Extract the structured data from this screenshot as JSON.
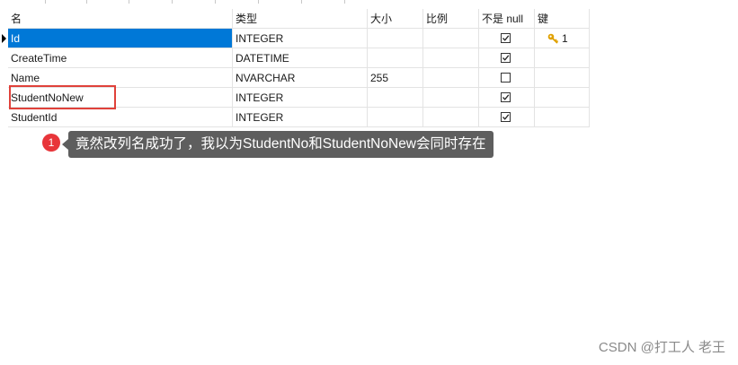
{
  "columns": {
    "name": "名",
    "type": "类型",
    "size": "大小",
    "scale": "比例",
    "not_null": "不是 null",
    "key": "键"
  },
  "rows": [
    {
      "name": "Id",
      "type": "INTEGER",
      "size": "",
      "scale": "",
      "not_null": true,
      "key": "1",
      "selected": true
    },
    {
      "name": "CreateTime",
      "type": "DATETIME",
      "size": "",
      "scale": "",
      "not_null": true,
      "key": ""
    },
    {
      "name": "Name",
      "type": "NVARCHAR",
      "size": "255",
      "scale": "",
      "not_null": false,
      "key": ""
    },
    {
      "name": "StudentNoNew",
      "type": "INTEGER",
      "size": "",
      "scale": "",
      "not_null": true,
      "key": "",
      "highlighted": true
    },
    {
      "name": "StudentId",
      "type": "INTEGER",
      "size": "",
      "scale": "",
      "not_null": true,
      "key": ""
    }
  ],
  "annotation": {
    "number": "1",
    "text": "竟然改列名成功了，我以为StudentNo和StudentNoNew会同时存在",
    "highlight_color": "#e0413a"
  },
  "watermark": "CSDN @打工人 老王",
  "colors": {
    "selection": "#0078d7",
    "tooltip": "#5e5e5e",
    "badge": "#e8353a",
    "key_icon": "#e0a100"
  }
}
